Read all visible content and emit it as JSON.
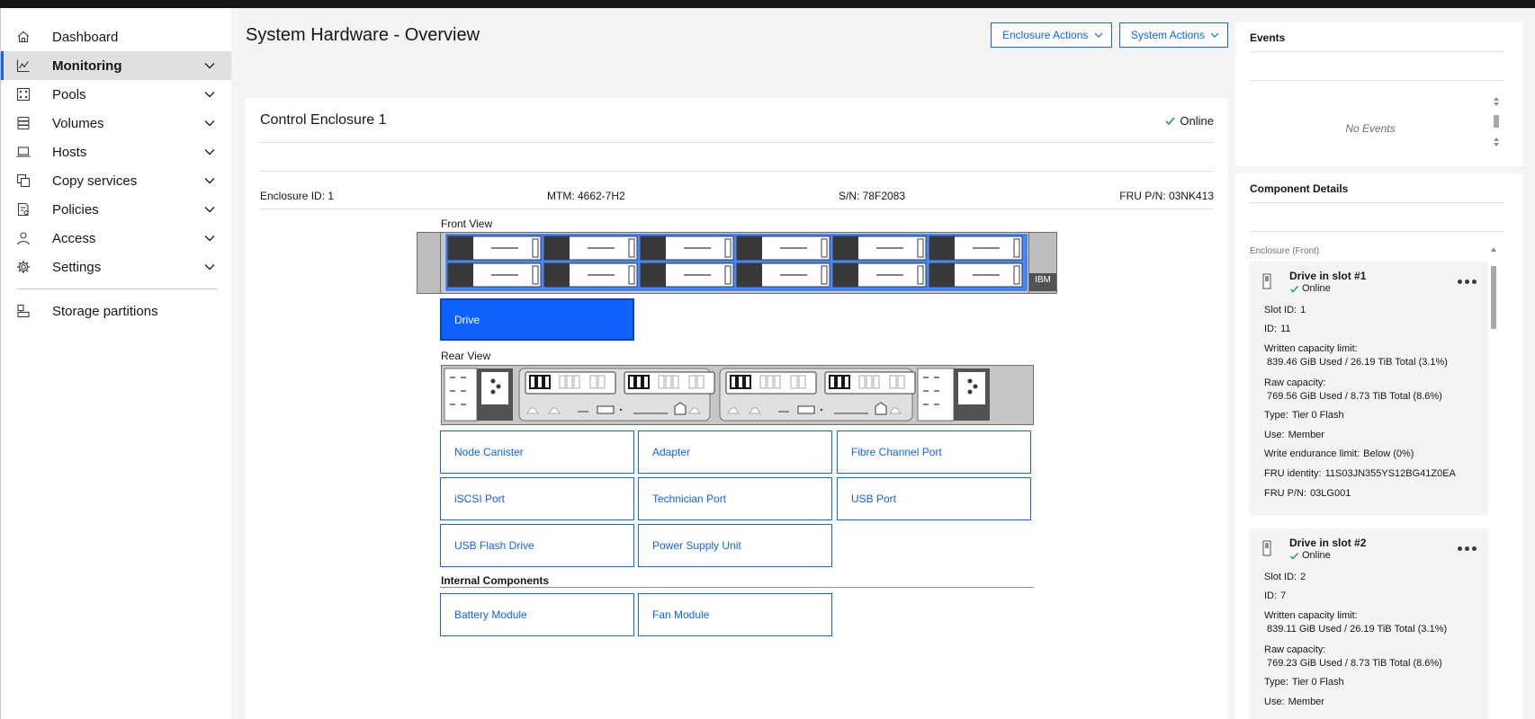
{
  "sidebar": {
    "items": [
      {
        "label": "Dashboard",
        "icon": "home-icon"
      },
      {
        "label": "Monitoring",
        "icon": "chart-line-icon"
      },
      {
        "label": "Pools",
        "icon": "pools-icon"
      },
      {
        "label": "Volumes",
        "icon": "volumes-icon"
      },
      {
        "label": "Hosts",
        "icon": "laptop-icon"
      },
      {
        "label": "Copy services",
        "icon": "copy-icon"
      },
      {
        "label": "Policies",
        "icon": "policy-icon"
      },
      {
        "label": "Access",
        "icon": "user-icon"
      },
      {
        "label": "Settings",
        "icon": "gear-icon"
      }
    ],
    "storage_partitions": "Storage partitions"
  },
  "header": {
    "title": "System Hardware - Overview",
    "enclosure_actions": "Enclosure Actions",
    "system_actions": "System Actions"
  },
  "enclosure": {
    "title": "Control Enclosure 1",
    "status": "Online",
    "id": "Enclosure ID: 1",
    "mtm": "MTM: 4662-7H2",
    "sn": "S/N: 78F2083",
    "fru": "FRU P/N: 03NK413",
    "front_view": "Front View",
    "rear_view": "Rear View",
    "brand": "IBM",
    "drive_button": "Drive",
    "components": [
      "Node Canister",
      "Adapter",
      "Fibre Channel Port",
      "iSCSI Port",
      "Technician Port",
      "USB Port",
      "USB Flash Drive",
      "Power Supply Unit"
    ],
    "internal_label": "Internal Components",
    "internal": [
      "Battery Module",
      "Fan Module"
    ]
  },
  "events": {
    "title": "Events",
    "empty": "No Events"
  },
  "component_details": {
    "title": "Component Details",
    "group": "Enclosure (Front)",
    "drives": [
      {
        "title": "Drive in slot #1",
        "status": "Online",
        "slot_label": "Slot ID:",
        "slot": "1",
        "id_label": "ID:",
        "id": "11",
        "written_label": "Written capacity limit:",
        "written": "839.46 GiB Used / 26.19 TiB Total (3.1%)",
        "raw_label": "Raw capacity:",
        "raw": "769.56 GiB Used / 8.73 TiB Total (8.6%)",
        "type_label": "Type:",
        "type": "Tier 0 Flash",
        "use_label": "Use:",
        "use": "Member",
        "endurance_label": "Write endurance limit:",
        "endurance": "Below (0%)",
        "fru_identity_label": "FRU identity:",
        "fru_identity": "11S03JN355YS12BG41Z0EA",
        "fru_pn_label": "FRU P/N:",
        "fru_pn": "03LG001"
      },
      {
        "title": "Drive in slot #2",
        "status": "Online",
        "slot_label": "Slot ID:",
        "slot": "2",
        "id_label": "ID:",
        "id": "7",
        "written_label": "Written capacity limit:",
        "written": "839.11 GiB Used / 26.19 TiB Total (3.1%)",
        "raw_label": "Raw capacity:",
        "raw": "769.23 GiB Used / 8.73 TiB Total (8.6%)",
        "type_label": "Type:",
        "type": "Tier 0 Flash",
        "use_label": "Use:",
        "use": "Member"
      }
    ]
  },
  "colors": {
    "accent": "#0f62fe",
    "online": "#24a148",
    "chassis": "#8d8d8d"
  }
}
